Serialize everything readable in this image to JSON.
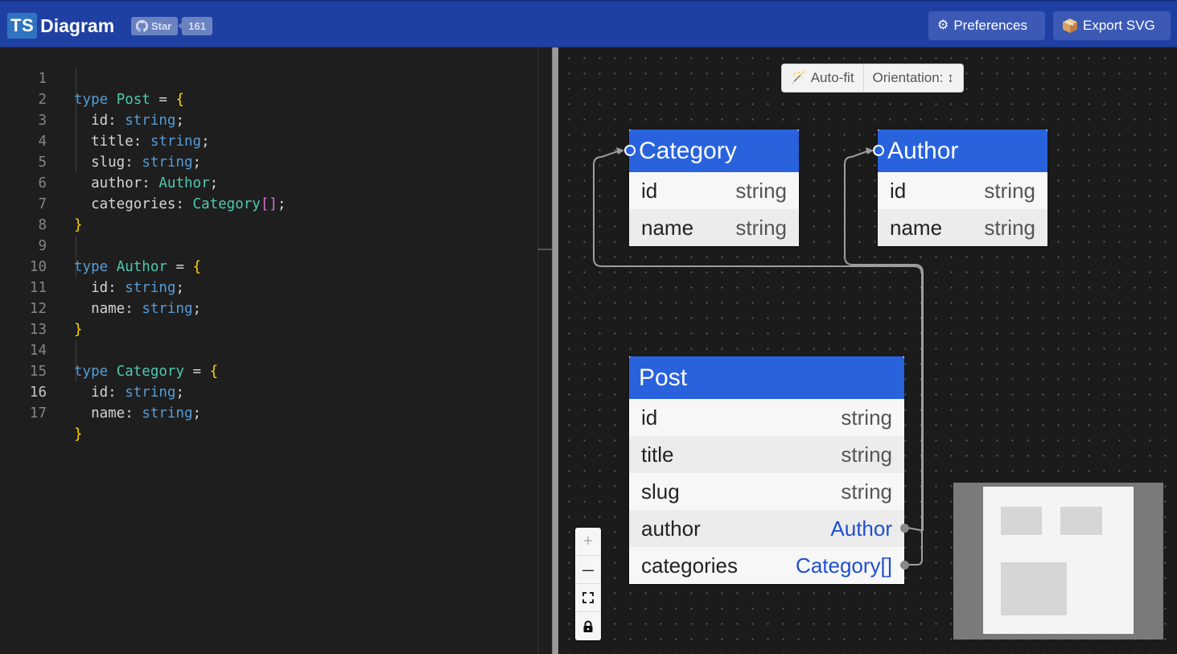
{
  "header": {
    "logo_badge": "TS",
    "logo_text": "Diagram",
    "star_label": "Star",
    "star_count": "161",
    "preferences_label": "Preferences",
    "export_label": "Export SVG",
    "preferences_icon": "gear-icon",
    "export_icon": "package-icon",
    "github_icon": "github-icon"
  },
  "editor": {
    "active_line": 16,
    "lines": [
      {
        "n": "1"
      },
      {
        "n": "2"
      },
      {
        "n": "3"
      },
      {
        "n": "4"
      },
      {
        "n": "5"
      },
      {
        "n": "6"
      },
      {
        "n": "7"
      },
      {
        "n": "8"
      },
      {
        "n": "9"
      },
      {
        "n": "10"
      },
      {
        "n": "11"
      },
      {
        "n": "12"
      },
      {
        "n": "13"
      },
      {
        "n": "14"
      },
      {
        "n": "15"
      },
      {
        "n": "16"
      },
      {
        "n": "17"
      }
    ],
    "tokens": {
      "type_kw": "type",
      "eq": "=",
      "open": "{",
      "close": "}",
      "post": "Post",
      "author": "Author",
      "category": "Category",
      "string": "string",
      "semi": ";",
      "arr": "[]",
      "id": "id:",
      "title": "title:",
      "slug": "slug:",
      "author_f": "author:",
      "categories_f": "categories:",
      "name": "name:"
    }
  },
  "toolbar": {
    "autofit_label": "Auto-fit",
    "autofit_icon": "magic-wand-icon",
    "orientation_label": "Orientation: ↕"
  },
  "nodes": {
    "category": {
      "title": "Category",
      "fields": [
        {
          "name": "id",
          "type": "string"
        },
        {
          "name": "name",
          "type": "string"
        }
      ]
    },
    "author": {
      "title": "Author",
      "fields": [
        {
          "name": "id",
          "type": "string"
        },
        {
          "name": "name",
          "type": "string"
        }
      ]
    },
    "post": {
      "title": "Post",
      "fields": [
        {
          "name": "id",
          "type": "string"
        },
        {
          "name": "title",
          "type": "string"
        },
        {
          "name": "slug",
          "type": "string"
        },
        {
          "name": "author",
          "type": "Author"
        },
        {
          "name": "categories",
          "type": "Category[]"
        }
      ]
    }
  },
  "controls": {
    "zoom_in": "+",
    "zoom_out": "—",
    "fit_icon": "fit-view-icon",
    "lock_icon": "lock-icon"
  }
}
